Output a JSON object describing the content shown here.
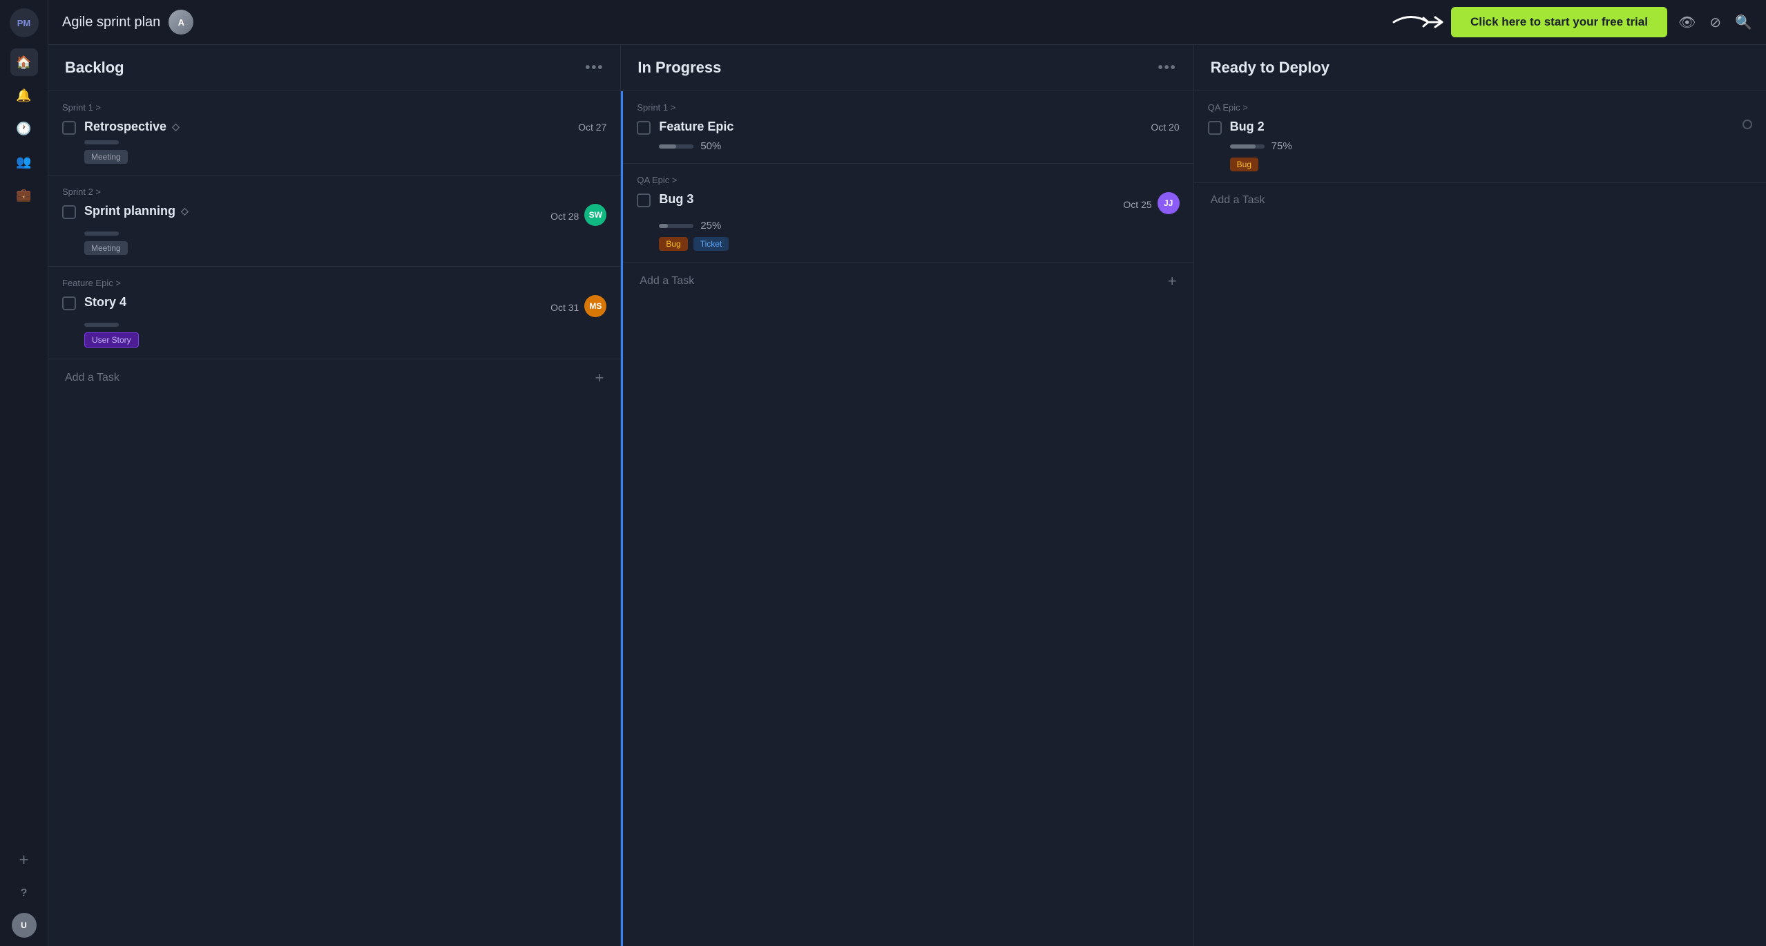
{
  "app": {
    "logo": "PM",
    "title": "Agile sprint plan",
    "cta": "Click here to start your free trial"
  },
  "sidebar": {
    "items": [
      {
        "icon": "🏠",
        "label": "Home",
        "active": true
      },
      {
        "icon": "🔔",
        "label": "Notifications",
        "active": false
      },
      {
        "icon": "🕐",
        "label": "Recent",
        "active": false
      },
      {
        "icon": "👥",
        "label": "Team",
        "active": false
      },
      {
        "icon": "💼",
        "label": "Portfolio",
        "active": false
      },
      {
        "icon": "+",
        "label": "Add",
        "active": false
      },
      {
        "icon": "?",
        "label": "Help",
        "active": false
      }
    ]
  },
  "board": {
    "columns": [
      {
        "id": "backlog",
        "title": "Backlog",
        "tasks": [
          {
            "id": "task-1",
            "epic": "Sprint 1 >",
            "title": "Retrospective",
            "diamond": true,
            "date": "Oct 27",
            "progress": 0,
            "progress_pct": null,
            "tags": [
              {
                "label": "Meeting",
                "type": "meeting"
              }
            ],
            "assignee": null
          },
          {
            "id": "task-2",
            "epic": "Sprint 2 >",
            "title": "Sprint planning",
            "diamond": true,
            "date": "Oct 28",
            "progress": 0,
            "progress_pct": null,
            "tags": [
              {
                "label": "Meeting",
                "type": "meeting"
              }
            ],
            "assignee": {
              "initials": "SW",
              "color": "#10b981"
            }
          },
          {
            "id": "task-3",
            "epic": "Feature Epic >",
            "title": "Story 4",
            "diamond": false,
            "date": "Oct 31",
            "progress": 0,
            "progress_pct": null,
            "tags": [
              {
                "label": "User Story",
                "type": "user-story"
              }
            ],
            "assignee": {
              "initials": "MS",
              "color": "#d97706"
            }
          }
        ],
        "add_task_label": "Add a Task"
      },
      {
        "id": "in-progress",
        "title": "In Progress",
        "tasks": [
          {
            "id": "task-4",
            "epic": "Sprint 1 >",
            "title": "Feature Epic",
            "diamond": false,
            "date": "Oct 20",
            "progress": 50,
            "progress_pct": "50%",
            "tags": [],
            "assignee": null
          },
          {
            "id": "task-5",
            "epic": "QA Epic >",
            "title": "Bug 3",
            "diamond": false,
            "date": "Oct 25",
            "progress": 25,
            "progress_pct": "25%",
            "tags": [
              {
                "label": "Bug",
                "type": "bug"
              },
              {
                "label": "Ticket",
                "type": "ticket"
              }
            ],
            "assignee": {
              "initials": "JJ",
              "color": "#8b5cf6"
            }
          }
        ],
        "add_task_label": "Add a Task"
      },
      {
        "id": "ready-to-deploy",
        "title": "Ready to Deploy",
        "tasks": [
          {
            "id": "task-6",
            "epic": "QA Epic >",
            "title": "Bug 2",
            "diamond": false,
            "date": null,
            "progress": 75,
            "progress_pct": "75%",
            "tags": [
              {
                "label": "Bug",
                "type": "bug"
              }
            ],
            "assignee": null
          }
        ],
        "add_task_label": "Add a Task"
      }
    ]
  }
}
